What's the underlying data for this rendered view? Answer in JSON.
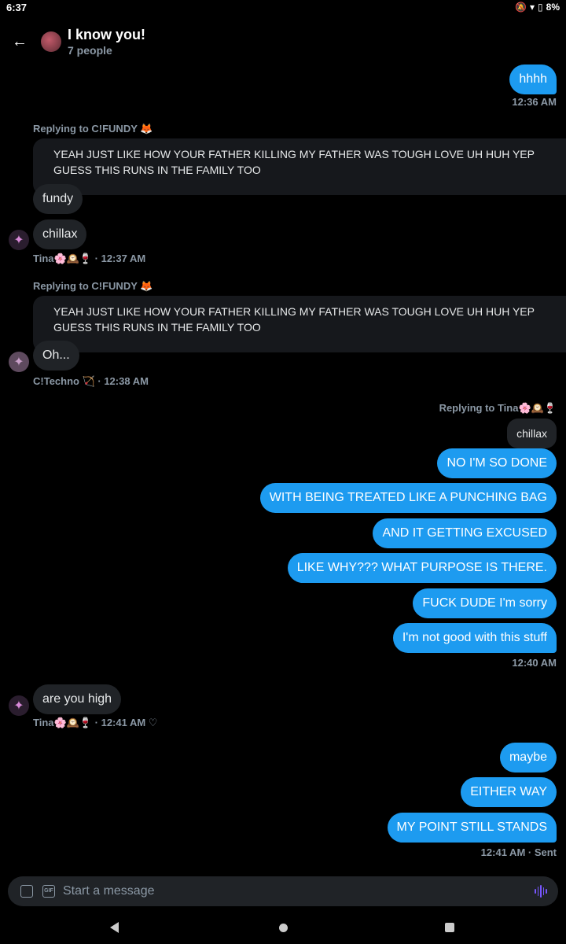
{
  "status": {
    "time": "6:37",
    "battery": "8%"
  },
  "header": {
    "title": "I know you!",
    "subtitle": "7 people"
  },
  "messages": [
    {
      "text": "hhhh",
      "meta": "12:36 AM"
    },
    {
      "reply_to": "Replying to C!FUNDY 🦊",
      "quote": "YEAH JUST LIKE HOW YOUR FATHER KILLING MY FATHER WAS TOUGH LOVE UH HUH YEP GUESS THIS RUNS IN THE FAMILY TOO"
    },
    {
      "text": "fundy"
    },
    {
      "text": "chillax",
      "meta": "Tina🌸🕰️🍷 · 12:37 AM"
    },
    {
      "reply_to": "Replying to C!FUNDY 🦊",
      "quote": "YEAH JUST LIKE HOW YOUR FATHER KILLING MY FATHER WAS TOUGH LOVE UH HUH YEP GUESS THIS RUNS IN THE FAMILY TOO"
    },
    {
      "text": "Oh...",
      "meta": "C!Techno 🏹 · 12:38 AM"
    },
    {
      "reply_to": "Replying to Tina🌸🕰️🍷",
      "quote": "chillax"
    },
    {
      "text": "NO I'M SO DONE"
    },
    {
      "text": "WITH BEING TREATED LIKE A PUNCHING BAG"
    },
    {
      "text": "AND IT GETTING EXCUSED"
    },
    {
      "text": "LIKE WHY??? WHAT PURPOSE IS THERE."
    },
    {
      "text": "FUCK DUDE I'm sorry"
    },
    {
      "text": "I'm not good with this stuff",
      "meta": "12:40 AM"
    },
    {
      "text": "are you high",
      "meta": "Tina🌸🕰️🍷 · 12:41 AM  ♡"
    },
    {
      "text": "maybe"
    },
    {
      "text": "EITHER WAY"
    },
    {
      "text": "MY POINT STILL STANDS",
      "meta": "12:41 AM · Sent"
    }
  ],
  "composer": {
    "placeholder": "Start a message"
  },
  "icons": {
    "back": "arrow-left-icon",
    "image": "image-icon",
    "gif": "gif-icon",
    "voice": "voice-icon"
  },
  "colors": {
    "accent": "#1d9bf0",
    "incoming": "#202327",
    "muted": "#8b98a5",
    "voice": "#7856ff"
  }
}
